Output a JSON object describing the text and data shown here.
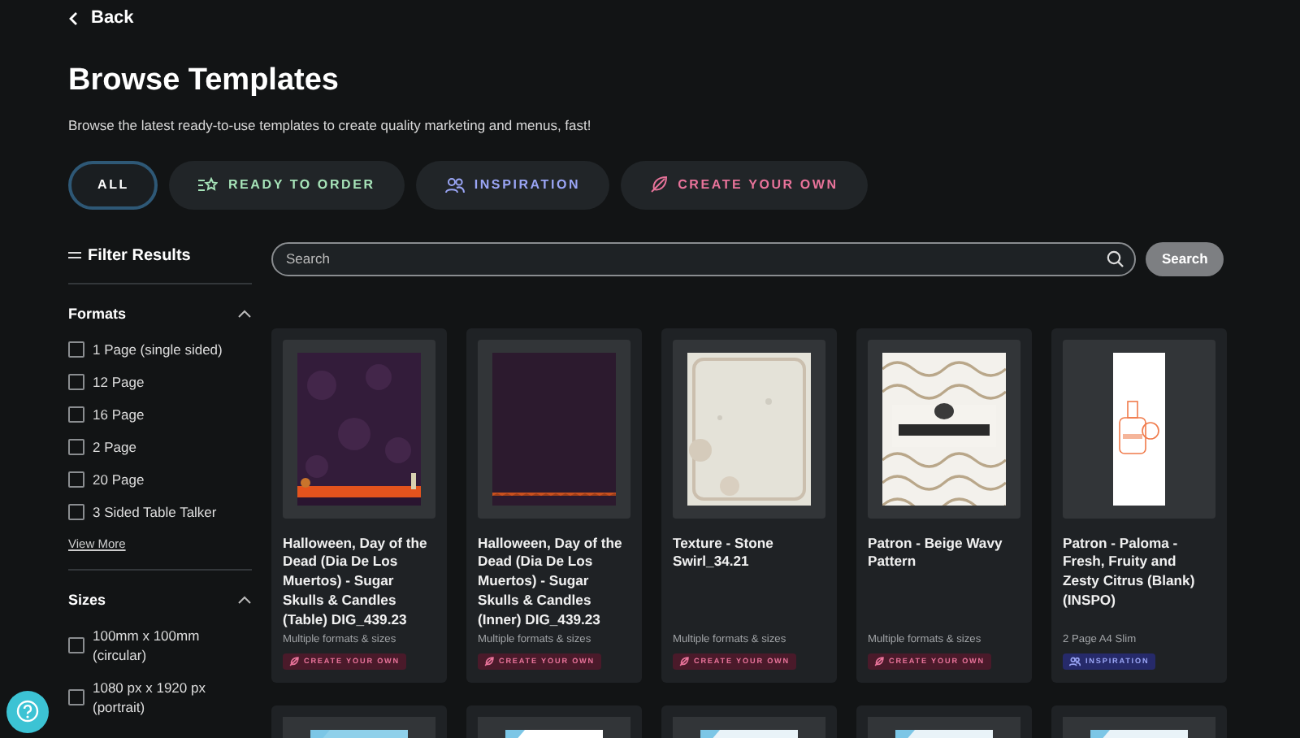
{
  "back": {
    "label": "Back"
  },
  "title": "Browse Templates",
  "subtitle": "Browse the latest ready-to-use templates to create quality marketing and menus, fast!",
  "tabs": [
    {
      "label": "ALL",
      "kind": "all",
      "color": "#ffffff",
      "selected": true
    },
    {
      "label": "READY TO ORDER",
      "kind": "ready",
      "color": "#a6e3b8",
      "selected": false
    },
    {
      "label": "INSPIRATION",
      "kind": "inspiration",
      "color": "#9aa5f5",
      "selected": false
    },
    {
      "label": "CREATE YOUR OWN",
      "kind": "create",
      "color": "#e8739a",
      "selected": false
    }
  ],
  "filter": {
    "title": "Filter Results",
    "groups": [
      {
        "title": "Formats",
        "expanded": true,
        "items": [
          {
            "label": "1 Page (single sided)",
            "checked": false
          },
          {
            "label": "12 Page",
            "checked": false
          },
          {
            "label": "16 Page",
            "checked": false
          },
          {
            "label": "2 Page",
            "checked": false
          },
          {
            "label": "20 Page",
            "checked": false
          },
          {
            "label": "3 Sided Table Talker",
            "checked": false
          }
        ],
        "more": "View More"
      },
      {
        "title": "Sizes",
        "expanded": true,
        "items": [
          {
            "label": "100mm x 100mm (circular)",
            "checked": false
          },
          {
            "label": "1080 px x 1920 px (portrait)",
            "checked": false
          }
        ]
      }
    ]
  },
  "search": {
    "placeholder": "Search",
    "button": "Search"
  },
  "cards": [
    {
      "title": "Halloween, Day of the Dead (Dia De Los Muertos) - Sugar Skulls & Candles (Table) DIG_439.23",
      "meta": "Multiple formats & sizes",
      "tag": {
        "label": "CREATE YOUR OWN",
        "kind": "create"
      }
    },
    {
      "title": "Halloween, Day of the Dead (Dia De Los Muertos) - Sugar Skulls & Candles (Inner) DIG_439.23",
      "meta": "Multiple formats & sizes",
      "tag": {
        "label": "CREATE YOUR OWN",
        "kind": "create"
      }
    },
    {
      "title": "Texture - Stone Swirl_34.21",
      "meta": "Multiple formats & sizes",
      "tag": {
        "label": "CREATE YOUR OWN",
        "kind": "create"
      }
    },
    {
      "title": "Patron - Beige Wavy Pattern",
      "meta": "Multiple formats & sizes",
      "tag": {
        "label": "CREATE YOUR OWN",
        "kind": "create"
      }
    },
    {
      "title": "Patron - Paloma - Fresh, Fruity and Zesty Citrus (Blank) (INSPO)",
      "meta": "2 Page A4 Slim",
      "tag": {
        "label": "INSPIRATION",
        "kind": "inspiration"
      }
    },
    {
      "kind": "picture"
    },
    {
      "kind": "picture"
    },
    {
      "kind": "picture"
    },
    {
      "kind": "picture"
    },
    {
      "kind": "picture"
    }
  ]
}
